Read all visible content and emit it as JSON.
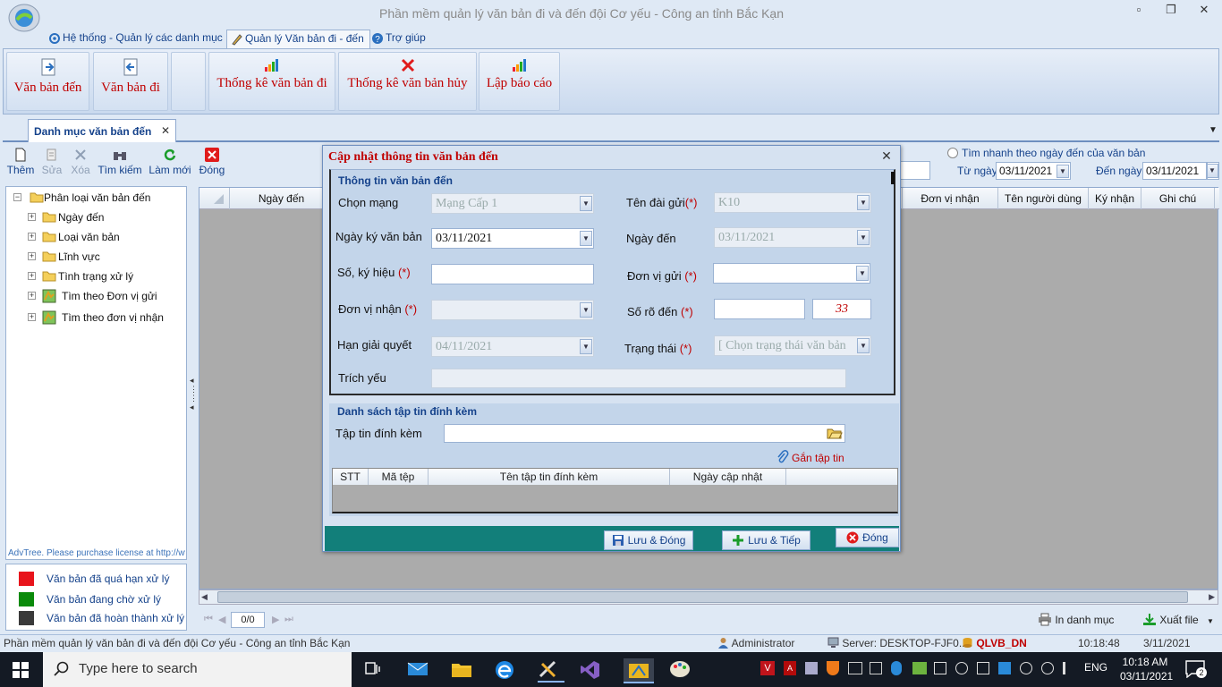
{
  "window": {
    "title": "Phần mềm quản lý văn bản đi và đến đội Cơ yếu - Công an tỉnh Bắc Kạn",
    "controls": [
      "▫",
      "❐",
      "✕"
    ]
  },
  "menu": {
    "tabs": [
      {
        "label": "Hệ thống - Quản lý các danh mục"
      },
      {
        "label": "Quản lý Văn bản đi - đến"
      },
      {
        "label": "Trợ giúp"
      }
    ]
  },
  "ribbon": {
    "buttons": [
      {
        "label": "Văn bản đến",
        "icon": "incoming-doc-icon"
      },
      {
        "label": "Văn bản đi",
        "icon": "outgoing-doc-icon"
      },
      {
        "label": "",
        "icon": ""
      },
      {
        "label": "Thống kê văn bản đi",
        "icon": "bar-chart-icon"
      },
      {
        "label": "Thống kê văn bản hủy",
        "icon": "red-x-icon"
      },
      {
        "label": "Lập báo cáo",
        "icon": "bar-chart-icon"
      }
    ]
  },
  "doc_tab": {
    "label": "Danh mục văn bản đến",
    "close": "✕"
  },
  "toolbar": {
    "add": "Thêm",
    "edit": "Sửa",
    "delete": "Xóa",
    "search": "Tìm kiếm",
    "refresh": "Làm mới",
    "close": "Đóng"
  },
  "quick_search": {
    "label": "Tìm nhanh theo ngày đến của văn bản",
    "from_label": "Từ ngày",
    "from_value": "03/11/2021",
    "to_label": "Đến ngày",
    "to_value": "03/11/2021"
  },
  "tree": {
    "root": "Phân loại văn bản đến",
    "items": [
      {
        "label": "Ngày đến",
        "icon": "folder-icon"
      },
      {
        "label": "Loại văn bản",
        "icon": "folder-icon"
      },
      {
        "label": "Lĩnh vực",
        "icon": "folder-icon"
      },
      {
        "label": "Tình trạng xử lý",
        "icon": "folder-icon"
      },
      {
        "label": "Tìm theo Đơn vị gửi",
        "icon": "map-icon"
      },
      {
        "label": "Tìm theo đơn vị nhận",
        "icon": "map-icon"
      }
    ],
    "footer": "AdvTree. Please purchase license at http://www"
  },
  "legend": {
    "items": [
      {
        "label": "Văn bản đã quá hạn xử lý",
        "color": "#e8141b"
      },
      {
        "label": "Văn bản đang chờ xử lý",
        "color": "#0a8a0a"
      },
      {
        "label": "Văn bản đã hoàn thành xử lý",
        "color": "#3a3a3a"
      }
    ]
  },
  "grid": {
    "columns_left": [
      "Ngày đến"
    ],
    "columns_right": [
      "Đơn vị nhận",
      "Tên người dùng",
      "Ký nhận",
      "Ghi chú"
    ]
  },
  "pager": {
    "position": "0/0",
    "print": "In danh mục",
    "export": "Xuất file"
  },
  "dialog": {
    "title": "Cập nhật thông tin văn bản đến",
    "close": "✕",
    "info_section": "Thông tin văn bản đến",
    "required_mark": "(*)",
    "fields": {
      "network_label": "Chọn mạng",
      "network_value": "Mạng Cấp 1",
      "station_label": "Tên đài gửi",
      "station_value": "K10",
      "sign_date_label": "Ngày ký văn bản",
      "sign_date_value": "03/11/2021",
      "arrive_date_label": "Ngày đến",
      "arrive_date_value": "03/11/2021",
      "number_label": "Số, ký hiệu",
      "number_value": "",
      "sender_label": "Đơn vị gửi",
      "sender_value": "",
      "receiver_label": "Đơn vị nhận",
      "receiver_value": "",
      "arrival_no_label": "Số rõ đến",
      "arrival_no_value": "",
      "arrival_no_count": "33",
      "deadline_label": "Hạn giải quyết",
      "deadline_value": "04/11/2021",
      "status_label": "Trạng thái",
      "status_value": "[ Chọn trạng thái văn bản",
      "summary_label": "Trích yếu",
      "summary_value": ""
    },
    "attach_section": "Danh sách tập tin đính kèm",
    "attach_label": "Tập tin đính kèm",
    "attach_value": "",
    "attach_button": "Gắn tập tin",
    "attach_columns": [
      "STT",
      "Mã tệp",
      "Tên tập tin đính kèm",
      "Ngày cập nhật"
    ],
    "buttons": {
      "save_close": "Lưu & Đóng",
      "save_next": "Lưu & Tiếp",
      "close": "Đóng"
    }
  },
  "status": {
    "app": "Phần mềm quản lý văn bản đi và đến đội Cơ yếu - Công an tỉnh Bắc Kạn",
    "user": "Administrator",
    "server": "Server: DESKTOP-FJF0...",
    "db": "QLVB_DN",
    "time": "10:18:48",
    "date": "3/11/2021"
  },
  "taskbar": {
    "search_placeholder": "Type here to search",
    "lang": "ENG",
    "clock_time": "10:18 AM",
    "clock_date": "03/11/2021",
    "notifications": "2"
  }
}
